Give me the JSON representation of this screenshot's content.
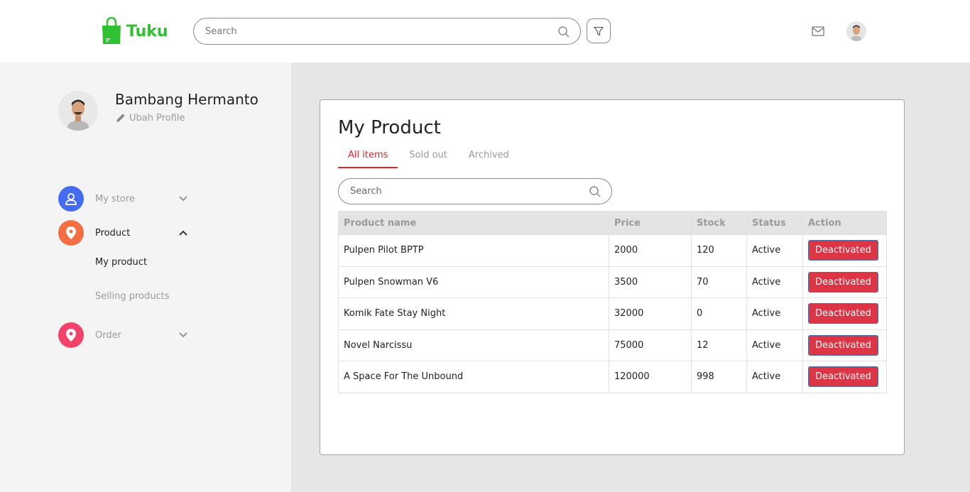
{
  "header": {
    "brand": "Tuku",
    "brand_color": "#2fc12f",
    "search_placeholder": "Search",
    "icons": [
      "shopping-bag-icon",
      "search-icon",
      "filter-icon",
      "mail-icon",
      "user-avatar"
    ]
  },
  "profile": {
    "name": "Bambang Hermanto",
    "edit_label": "Ubah Profile"
  },
  "sidebar": {
    "items": [
      {
        "label": "My store",
        "icon": "user-icon",
        "color": "#456bf0"
      },
      {
        "label": "Product",
        "icon": "location-pin-icon",
        "color": "#f36f43"
      },
      {
        "label": "Order",
        "icon": "location-pin-icon",
        "color": "#f2436b"
      }
    ],
    "product_sub": [
      "My product",
      "Selling products"
    ]
  },
  "main": {
    "title": "My Product",
    "tabs": [
      "All items",
      "Sold out",
      "Archived"
    ],
    "search_placeholder": "Search",
    "table": {
      "headers": [
        "Product name",
        "Price",
        "Stock",
        "Status",
        "Action"
      ],
      "rows": [
        {
          "name": "Pulpen Pilot BPTP",
          "price": "2000",
          "stock": "120",
          "status": "Active",
          "action": "Deactivated"
        },
        {
          "name": "Pulpen Snowman V6",
          "price": "3500",
          "stock": "70",
          "status": "Active",
          "action": "Deactivated"
        },
        {
          "name": "Komik Fate Stay Night",
          "price": "32000",
          "stock": "0",
          "status": "Active",
          "action": "Deactivated"
        },
        {
          "name": "Novel Narcissu",
          "price": "75000",
          "stock": "12",
          "status": "Active",
          "action": "Deactivated"
        },
        {
          "name": "A Space For The Unbound",
          "price": "120000",
          "stock": "998",
          "status": "Active",
          "action": "Deactivated"
        }
      ]
    },
    "accent_color": "#d8252f",
    "button_color": "#dc3545"
  }
}
